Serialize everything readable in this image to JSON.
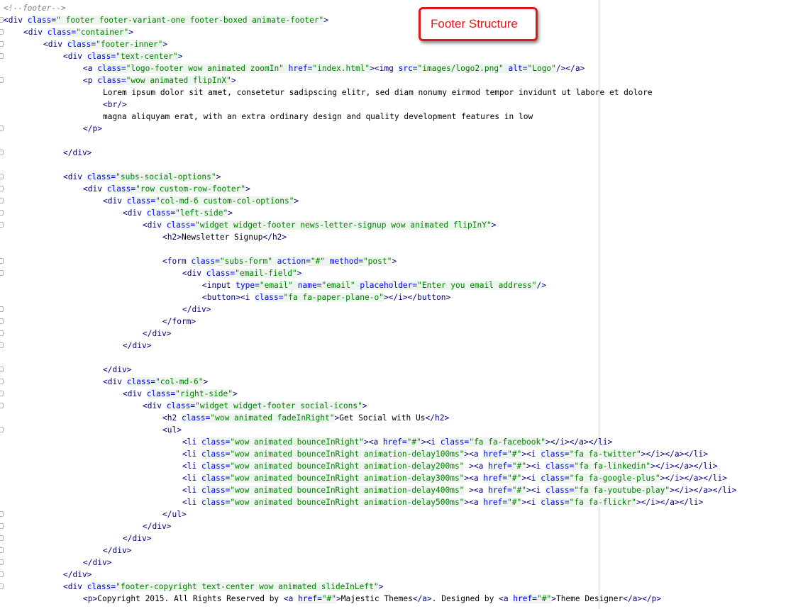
{
  "annotation": {
    "label": "Footer Structure",
    "color": "#e01818"
  },
  "colors": {
    "tag": "#000080",
    "attr": "#0000ff",
    "value": "#008000",
    "comment": "#808080"
  },
  "lines": [
    {
      "indent": 0,
      "fold": false,
      "segs": [
        [
          "c",
          "<!--footer-->"
        ]
      ]
    },
    {
      "indent": 0,
      "fold": true,
      "segs": [
        [
          "t",
          "<div "
        ],
        [
          "a",
          "class="
        ],
        [
          "v",
          "\" footer footer-variant-one footer-boxed animate-footer\""
        ],
        [
          "t",
          ">"
        ]
      ]
    },
    {
      "indent": 4,
      "fold": true,
      "segs": [
        [
          "t",
          "<div "
        ],
        [
          "a",
          "class="
        ],
        [
          "v",
          "\"container\""
        ],
        [
          "t",
          ">"
        ]
      ]
    },
    {
      "indent": 8,
      "fold": true,
      "segs": [
        [
          "t",
          "<div "
        ],
        [
          "a",
          "class="
        ],
        [
          "v",
          "\"footer-inner\""
        ],
        [
          "t",
          ">"
        ]
      ]
    },
    {
      "indent": 12,
      "fold": true,
      "segs": [
        [
          "t",
          "<div "
        ],
        [
          "a",
          "class="
        ],
        [
          "v",
          "\"text-center\""
        ],
        [
          "t",
          ">"
        ]
      ]
    },
    {
      "indent": 16,
      "fold": false,
      "segs": [
        [
          "t",
          "<a "
        ],
        [
          "a",
          "class="
        ],
        [
          "v",
          "\"logo-footer wow animated zoomIn\""
        ],
        [
          "a",
          " href="
        ],
        [
          "v",
          "\"index.html\""
        ],
        [
          "t",
          "><img "
        ],
        [
          "a",
          "src="
        ],
        [
          "v",
          "\"images/logo2.png\""
        ],
        [
          "a",
          " alt="
        ],
        [
          "v",
          "\"Logo\""
        ],
        [
          "t",
          "/></a>"
        ]
      ]
    },
    {
      "indent": 16,
      "fold": true,
      "segs": [
        [
          "t",
          "<p "
        ],
        [
          "a",
          "class="
        ],
        [
          "v",
          "\"wow animated flipInX\""
        ],
        [
          "t",
          ">"
        ]
      ]
    },
    {
      "indent": 20,
      "fold": false,
      "segs": [
        [
          "x",
          "Lorem ipsum dolor sit amet, consetetur sadipscing elitr, sed diam nonumy eirmod tempor invidunt ut labore et dolore"
        ]
      ]
    },
    {
      "indent": 20,
      "fold": false,
      "segs": [
        [
          "t",
          "<br/>"
        ]
      ]
    },
    {
      "indent": 20,
      "fold": false,
      "segs": [
        [
          "x",
          "magna aliquyam erat, with an extra ordinary design and quality development features in low"
        ]
      ]
    },
    {
      "indent": 16,
      "fold": true,
      "segs": [
        [
          "t",
          "</p>"
        ]
      ]
    },
    {
      "indent": 0,
      "fold": false,
      "segs": []
    },
    {
      "indent": 12,
      "fold": true,
      "segs": [
        [
          "t",
          "</div>"
        ]
      ]
    },
    {
      "indent": 0,
      "fold": false,
      "segs": []
    },
    {
      "indent": 12,
      "fold": true,
      "segs": [
        [
          "t",
          "<div "
        ],
        [
          "a",
          "class="
        ],
        [
          "v",
          "\"subs-social-options\""
        ],
        [
          "t",
          ">"
        ]
      ]
    },
    {
      "indent": 16,
      "fold": true,
      "segs": [
        [
          "t",
          "<div "
        ],
        [
          "a",
          "class="
        ],
        [
          "v",
          "\"row custom-row-footer\""
        ],
        [
          "t",
          ">"
        ]
      ]
    },
    {
      "indent": 20,
      "fold": true,
      "segs": [
        [
          "t",
          "<div "
        ],
        [
          "a",
          "class="
        ],
        [
          "v",
          "\"col-md-6 custom-col-options\""
        ],
        [
          "t",
          ">"
        ]
      ]
    },
    {
      "indent": 24,
      "fold": true,
      "segs": [
        [
          "t",
          "<div "
        ],
        [
          "a",
          "class="
        ],
        [
          "v",
          "\"left-side\""
        ],
        [
          "t",
          ">"
        ]
      ]
    },
    {
      "indent": 28,
      "fold": true,
      "segs": [
        [
          "t",
          "<div "
        ],
        [
          "a",
          "class="
        ],
        [
          "v",
          "\"widget widget-footer news-letter-signup wow animated flipInY\""
        ],
        [
          "t",
          ">"
        ]
      ]
    },
    {
      "indent": 32,
      "fold": false,
      "segs": [
        [
          "t",
          "<h2>"
        ],
        [
          "x",
          "Newsletter Signup"
        ],
        [
          "t",
          "</h2>"
        ]
      ]
    },
    {
      "indent": 0,
      "fold": false,
      "segs": []
    },
    {
      "indent": 32,
      "fold": true,
      "segs": [
        [
          "t",
          "<form "
        ],
        [
          "a",
          "class="
        ],
        [
          "v",
          "\"subs-form\""
        ],
        [
          "a",
          " action="
        ],
        [
          "v",
          "\"#\""
        ],
        [
          "a",
          " method="
        ],
        [
          "v",
          "\"post\""
        ],
        [
          "t",
          ">"
        ]
      ]
    },
    {
      "indent": 36,
      "fold": true,
      "segs": [
        [
          "t",
          "<div "
        ],
        [
          "a",
          "class="
        ],
        [
          "v",
          "\"email-field\""
        ],
        [
          "t",
          ">"
        ]
      ]
    },
    {
      "indent": 40,
      "fold": false,
      "segs": [
        [
          "t",
          "<input "
        ],
        [
          "a",
          "type="
        ],
        [
          "v",
          "\"email\""
        ],
        [
          "a",
          " name="
        ],
        [
          "v",
          "\"email\""
        ],
        [
          "a",
          " placeholder="
        ],
        [
          "v",
          "\"Enter you email address\""
        ],
        [
          "t",
          "/>"
        ]
      ]
    },
    {
      "indent": 40,
      "fold": false,
      "segs": [
        [
          "t",
          "<button><i "
        ],
        [
          "a",
          "class="
        ],
        [
          "v",
          "\"fa fa-paper-plane-o\""
        ],
        [
          "t",
          "></i></button>"
        ]
      ]
    },
    {
      "indent": 36,
      "fold": true,
      "segs": [
        [
          "t",
          "</div>"
        ]
      ]
    },
    {
      "indent": 32,
      "fold": true,
      "segs": [
        [
          "t",
          "</form>"
        ]
      ]
    },
    {
      "indent": 28,
      "fold": true,
      "segs": [
        [
          "t",
          "</div>"
        ]
      ]
    },
    {
      "indent": 24,
      "fold": true,
      "segs": [
        [
          "t",
          "</div>"
        ]
      ]
    },
    {
      "indent": 0,
      "fold": false,
      "segs": []
    },
    {
      "indent": 20,
      "fold": true,
      "segs": [
        [
          "t",
          "</div>"
        ]
      ]
    },
    {
      "indent": 20,
      "fold": true,
      "segs": [
        [
          "t",
          "<div "
        ],
        [
          "a",
          "class="
        ],
        [
          "v",
          "\"col-md-6\""
        ],
        [
          "t",
          ">"
        ]
      ]
    },
    {
      "indent": 24,
      "fold": true,
      "segs": [
        [
          "t",
          "<div "
        ],
        [
          "a",
          "class="
        ],
        [
          "v",
          "\"right-side\""
        ],
        [
          "t",
          ">"
        ]
      ]
    },
    {
      "indent": 28,
      "fold": true,
      "segs": [
        [
          "t",
          "<div "
        ],
        [
          "a",
          "class="
        ],
        [
          "v",
          "\"widget widget-footer social-icons\""
        ],
        [
          "t",
          ">"
        ]
      ]
    },
    {
      "indent": 32,
      "fold": false,
      "segs": [
        [
          "t",
          "<h2 "
        ],
        [
          "a",
          "class="
        ],
        [
          "v",
          "\"wow animated fadeInRight\""
        ],
        [
          "t",
          ">"
        ],
        [
          "x",
          "Get Social with Us"
        ],
        [
          "t",
          "</h2>"
        ]
      ]
    },
    {
      "indent": 32,
      "fold": true,
      "segs": [
        [
          "t",
          "<ul>"
        ]
      ]
    },
    {
      "indent": 36,
      "fold": false,
      "segs": [
        [
          "t",
          "<li "
        ],
        [
          "a",
          "class="
        ],
        [
          "v",
          "\"wow animated bounceInRight\""
        ],
        [
          "t",
          "><a "
        ],
        [
          "a",
          "href="
        ],
        [
          "v",
          "\"#\""
        ],
        [
          "t",
          "><i "
        ],
        [
          "a",
          "class="
        ],
        [
          "v",
          "\"fa fa-facebook\""
        ],
        [
          "t",
          "></i></a></li>"
        ]
      ]
    },
    {
      "indent": 36,
      "fold": false,
      "segs": [
        [
          "t",
          "<li "
        ],
        [
          "a",
          "class="
        ],
        [
          "v",
          "\"wow animated bounceInRight animation-delay100ms\""
        ],
        [
          "t",
          "><a "
        ],
        [
          "a",
          "href="
        ],
        [
          "v",
          "\"#\""
        ],
        [
          "t",
          "><i "
        ],
        [
          "a",
          "class="
        ],
        [
          "v",
          "\"fa fa-twitter\""
        ],
        [
          "t",
          "></i></a></li>"
        ]
      ]
    },
    {
      "indent": 36,
      "fold": false,
      "segs": [
        [
          "t",
          "<li "
        ],
        [
          "a",
          "class="
        ],
        [
          "v",
          "\"wow animated bounceInRight animation-delay200ms\""
        ],
        [
          "t",
          " ><a "
        ],
        [
          "a",
          "href="
        ],
        [
          "v",
          "\"#\""
        ],
        [
          "t",
          "><i "
        ],
        [
          "a",
          "class="
        ],
        [
          "v",
          "\"fa fa-linkedin\""
        ],
        [
          "t",
          "></i></a></li>"
        ]
      ]
    },
    {
      "indent": 36,
      "fold": false,
      "segs": [
        [
          "t",
          "<li "
        ],
        [
          "a",
          "class="
        ],
        [
          "v",
          "\"wow animated bounceInRight animation-delay300ms\""
        ],
        [
          "t",
          "><a "
        ],
        [
          "a",
          "href="
        ],
        [
          "v",
          "\"#\""
        ],
        [
          "t",
          "><i "
        ],
        [
          "a",
          "class="
        ],
        [
          "v",
          "\"fa fa-google-plus\""
        ],
        [
          "t",
          "></i></a></li>"
        ]
      ]
    },
    {
      "indent": 36,
      "fold": false,
      "segs": [
        [
          "t",
          "<li "
        ],
        [
          "a",
          "class="
        ],
        [
          "v",
          "\"wow animated bounceInRight animation-delay400ms\""
        ],
        [
          "t",
          " ><a "
        ],
        [
          "a",
          "href="
        ],
        [
          "v",
          "\"#\""
        ],
        [
          "t",
          "><i "
        ],
        [
          "a",
          "class="
        ],
        [
          "v",
          "\"fa fa-youtube-play\""
        ],
        [
          "t",
          "></i></a></li>"
        ]
      ]
    },
    {
      "indent": 36,
      "fold": false,
      "segs": [
        [
          "t",
          "<li "
        ],
        [
          "a",
          "class="
        ],
        [
          "v",
          "\"wow animated bounceInRight animation-delay500ms\""
        ],
        [
          "t",
          "><a "
        ],
        [
          "a",
          "href="
        ],
        [
          "v",
          "\"#\""
        ],
        [
          "t",
          "><i "
        ],
        [
          "a",
          "class="
        ],
        [
          "v",
          "\"fa fa-flickr\""
        ],
        [
          "t",
          "></i></a></li>"
        ]
      ]
    },
    {
      "indent": 32,
      "fold": true,
      "segs": [
        [
          "t",
          "</ul>"
        ]
      ]
    },
    {
      "indent": 28,
      "fold": true,
      "segs": [
        [
          "t",
          "</div>"
        ]
      ]
    },
    {
      "indent": 24,
      "fold": true,
      "segs": [
        [
          "t",
          "</div>"
        ]
      ]
    },
    {
      "indent": 20,
      "fold": true,
      "segs": [
        [
          "t",
          "</div>"
        ]
      ]
    },
    {
      "indent": 16,
      "fold": true,
      "segs": [
        [
          "t",
          "</div>"
        ]
      ]
    },
    {
      "indent": 12,
      "fold": true,
      "segs": [
        [
          "t",
          "</div>"
        ]
      ]
    },
    {
      "indent": 12,
      "fold": true,
      "segs": [
        [
          "t",
          "<div "
        ],
        [
          "a",
          "class="
        ],
        [
          "v",
          "\"footer-copyright text-center wow animated slideInLeft\""
        ],
        [
          "t",
          ">"
        ]
      ]
    },
    {
      "indent": 16,
      "fold": false,
      "segs": [
        [
          "t",
          "<p>"
        ],
        [
          "x",
          "Copyright 2015. All Rights Reserved by "
        ],
        [
          "t",
          "<a "
        ],
        [
          "a",
          "href="
        ],
        [
          "v",
          "\"#\""
        ],
        [
          "t",
          ">"
        ],
        [
          "x",
          "Majestic Themes"
        ],
        [
          "t",
          "</a>"
        ],
        [
          "x",
          ". Designed by "
        ],
        [
          "t",
          "<a "
        ],
        [
          "a",
          "href="
        ],
        [
          "v",
          "\"#\""
        ],
        [
          "t",
          ">"
        ],
        [
          "x",
          "Theme Designer"
        ],
        [
          "t",
          "</a></p>"
        ]
      ]
    }
  ]
}
